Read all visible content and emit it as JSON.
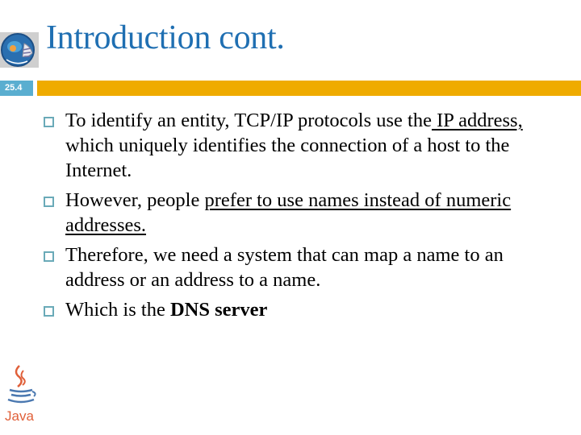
{
  "slide": {
    "title": "Introduction cont.",
    "section_number": "25.4",
    "colors": {
      "title": "#1f6fb2",
      "section_tag": "#5aaed0",
      "section_bar": "#efab00",
      "bullet_box": "#6aaab8"
    },
    "logos": {
      "top_left": "globe-network-logo",
      "bottom_left": "java-logo",
      "bottom_left_label": "Java"
    },
    "bullets": [
      {
        "segments": [
          {
            "text": "To identify an entity, TCP/IP protocols use the",
            "style": "normal"
          },
          {
            "text": " IP address, ",
            "style": "underline"
          },
          {
            "text": "which uniquely identifies the connection of a host to the Internet.",
            "style": "normal"
          }
        ]
      },
      {
        "segments": [
          {
            "text": " However, people ",
            "style": "normal"
          },
          {
            "text": "prefer to use names instead of numeric addresses.",
            "style": "underline"
          }
        ]
      },
      {
        "segments": [
          {
            "text": "Therefore, we need a system that can map a name to an address or an address to a name.",
            "style": "normal"
          }
        ]
      },
      {
        "segments": [
          {
            "text": "Which is the ",
            "style": "normal"
          },
          {
            "text": "DNS server",
            "style": "bold"
          }
        ]
      }
    ]
  }
}
